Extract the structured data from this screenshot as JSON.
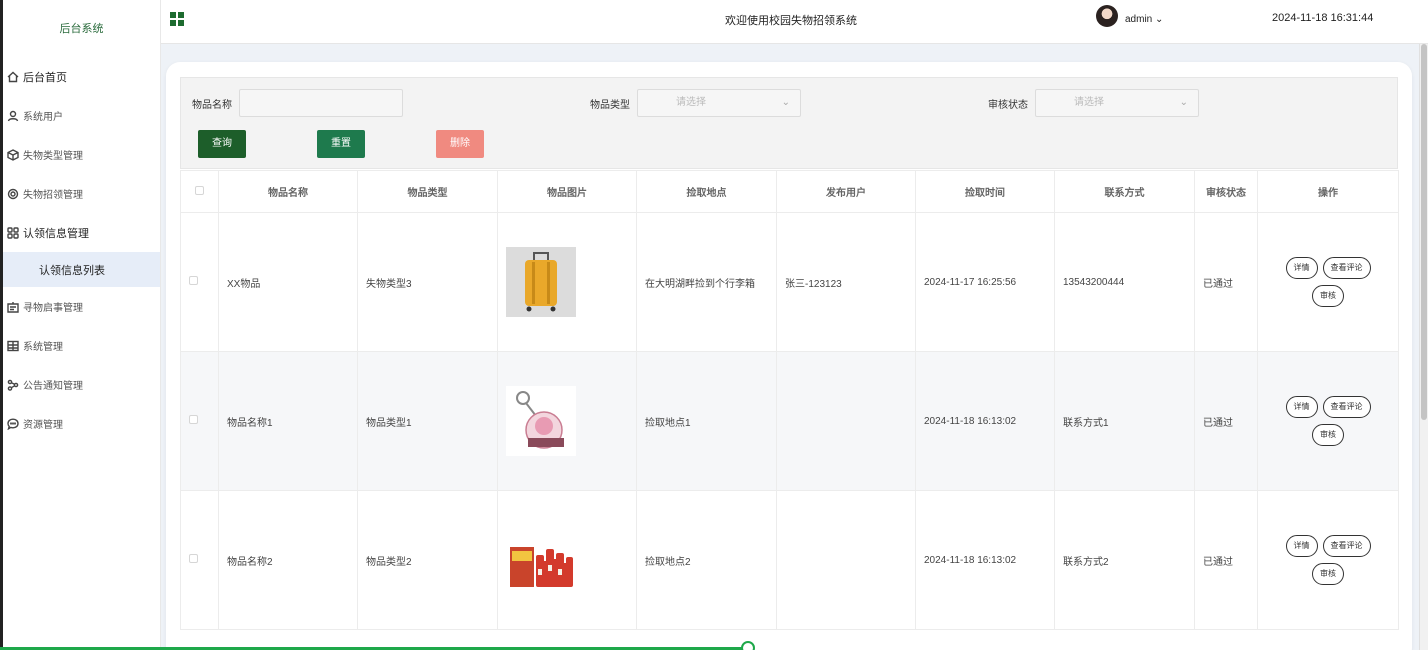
{
  "sidebar": {
    "brand": "后台系统",
    "items": [
      {
        "label": "后台首页",
        "icon": "home-icon"
      },
      {
        "label": "系统用户",
        "icon": "user-icon"
      },
      {
        "label": "失物类型管理",
        "icon": "cube-icon"
      },
      {
        "label": "失物招领管理",
        "icon": "gear-icon"
      },
      {
        "label": "认领信息管理",
        "icon": "grid-icon"
      },
      {
        "label": "认领信息列表",
        "icon": ""
      },
      {
        "label": "寻物启事管理",
        "icon": "board-icon"
      },
      {
        "label": "系统管理",
        "icon": "layout-icon"
      },
      {
        "label": "公告通知管理",
        "icon": "share-icon"
      },
      {
        "label": "资源管理",
        "icon": "chat-icon"
      }
    ]
  },
  "header": {
    "welcome": "欢迎使用校园失物招领系统",
    "user": "admin",
    "time": "2024-11-18 16:31:44"
  },
  "search": {
    "name_label": "物品名称",
    "name_value": "",
    "type_label": "物品类型",
    "type_placeholder": "请选择",
    "status_label": "审核状态",
    "status_placeholder": "请选择",
    "query_btn": "查询",
    "reset_btn": "重置",
    "delete_btn": "删除"
  },
  "table": {
    "headers": [
      "物品名称",
      "物品类型",
      "物品图片",
      "捡取地点",
      "发布用户",
      "捡取时间",
      "联系方式",
      "审核状态",
      "操作"
    ],
    "rows": [
      {
        "name": "XX物品",
        "type": "失物类型3",
        "image": "suitcase",
        "place": "在大明湖畔捡到个行李箱",
        "user": "张三-123123",
        "time": "2024-11-17 16:25:56",
        "contact": "13543200444",
        "status": "已通过"
      },
      {
        "name": "物品名称1",
        "type": "物品类型1",
        "image": "keychain",
        "place": "捡取地点1",
        "user": "",
        "time": "2024-11-18 16:13:02",
        "contact": "联系方式1",
        "status": "已通过"
      },
      {
        "name": "物品名称2",
        "type": "物品类型2",
        "image": "bottles",
        "place": "捡取地点2",
        "user": "",
        "time": "2024-11-18 16:13:02",
        "contact": "联系方式2",
        "status": "已通过"
      }
    ],
    "ops": {
      "detail": "详情",
      "comments": "查看评论",
      "review": "审核"
    }
  },
  "colors": {
    "primary": "#1d5e2a",
    "reset": "#1e7a4d",
    "delete": "#f08a80",
    "selected_bg": "#e6edf8"
  }
}
